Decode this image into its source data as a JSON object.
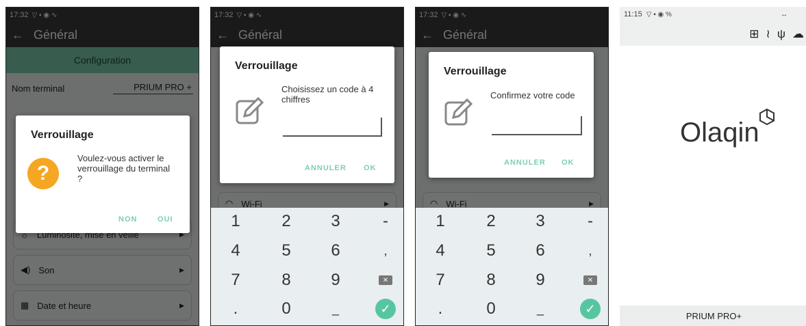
{
  "screens": [
    {
      "status": {
        "time": "17:32"
      },
      "appbar": {
        "back_icon": "arrow-left-icon",
        "title": "Général"
      },
      "section": "Configuration",
      "terminal_name": {
        "label": "Nom terminal",
        "value": "PRIUM PRO +"
      },
      "cards": [
        {
          "icon": "brightness-icon",
          "label": "Luminosité, mise en veille"
        },
        {
          "icon": "volume-icon",
          "label": "Son"
        },
        {
          "icon": "calendar-icon",
          "label": "Date et heure"
        }
      ],
      "dialog": {
        "title": "Verrouillage",
        "message": "Voulez-vous activer le verrouillage du terminal ?",
        "no": "NON",
        "yes": "OUI"
      }
    },
    {
      "status": {
        "time": "17:32"
      },
      "appbar": {
        "title": "Général"
      },
      "wifi_label": "Wi-Fi",
      "dialog": {
        "title": "Verrouillage",
        "message": "Choisissez un code à 4 chiffres",
        "cancel": "ANNULER",
        "ok": "OK"
      }
    },
    {
      "status": {
        "time": "17:32"
      },
      "appbar": {
        "title": "Général"
      },
      "wifi_label": "Wi-Fi",
      "dialog": {
        "title": "Verrouillage",
        "message": "Confirmez votre code",
        "cancel": "ANNULER",
        "ok": "OK"
      }
    },
    {
      "status": {
        "time": "11:15"
      },
      "logo": "Olaqin",
      "footer": "PRIUM PRO+"
    }
  ],
  "keypad": [
    "1",
    "2",
    "3",
    "-",
    "4",
    "5",
    "6",
    ",",
    "7",
    "8",
    "9",
    "",
    ".",
    "0",
    "_",
    ""
  ],
  "colors": {
    "accent": "#7dcfae",
    "question": "#f5a623",
    "ok_key": "#56c6a1"
  }
}
